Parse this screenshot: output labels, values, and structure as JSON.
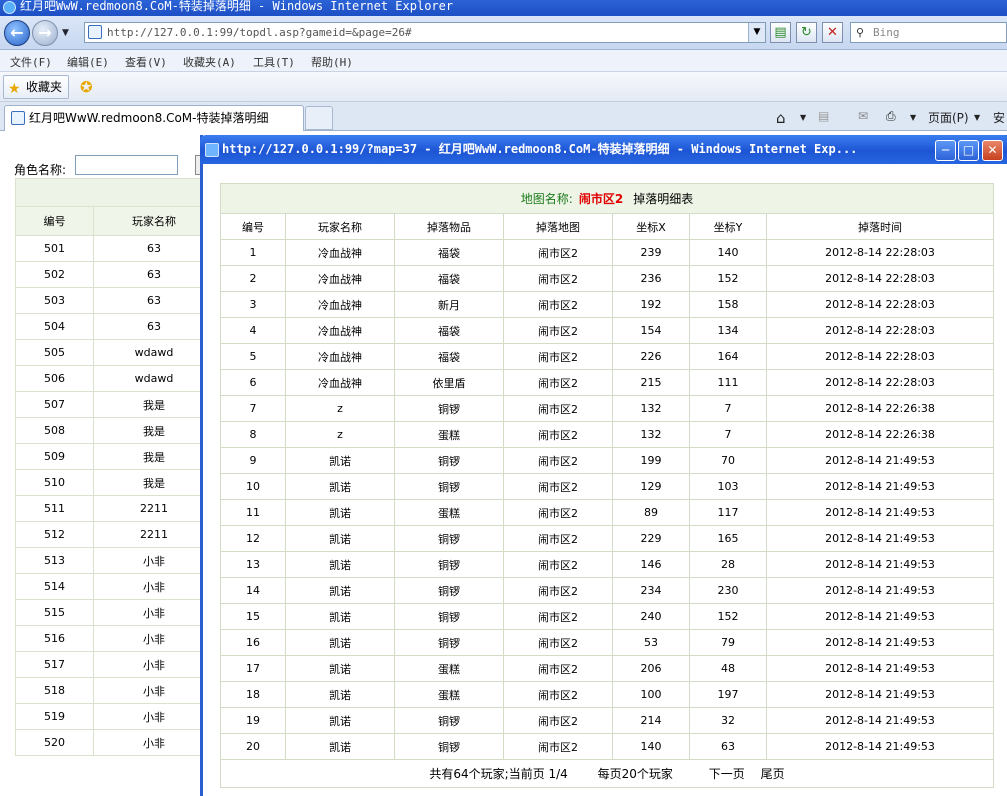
{
  "window": {
    "title": "红月吧WwW.redmoon8.CoM-特装掉落明细 - Windows Internet Explorer"
  },
  "address": {
    "url": "http://127.0.0.1:99/topdl.asp?gameid=&page=26#",
    "search_placeholder": "Bing"
  },
  "menu": [
    "文件(F)",
    "编辑(E)",
    "查看(V)",
    "收藏夹(A)",
    "工具(T)",
    "帮助(H)"
  ],
  "favorites": {
    "label": "收藏夹"
  },
  "tab": {
    "label": "红月吧WwW.redmoon8.CoM-特装掉落明细"
  },
  "commands": {
    "page": "页面(P)",
    "safety": "安"
  },
  "bg_page": {
    "search_label": "角色名称:",
    "headers": [
      "编号",
      "玩家名称"
    ],
    "rows": [
      [
        "501",
        "63"
      ],
      [
        "502",
        "63"
      ],
      [
        "503",
        "63"
      ],
      [
        "504",
        "63"
      ],
      [
        "505",
        "wdawd"
      ],
      [
        "506",
        "wdawd"
      ],
      [
        "507",
        "我是"
      ],
      [
        "508",
        "我是"
      ],
      [
        "509",
        "我是"
      ],
      [
        "510",
        "我是"
      ],
      [
        "511",
        "2211"
      ],
      [
        "512",
        "2211"
      ],
      [
        "513",
        "小非"
      ],
      [
        "514",
        "小非"
      ],
      [
        "515",
        "小非"
      ],
      [
        "516",
        "小非"
      ],
      [
        "517",
        "小非"
      ],
      [
        "518",
        "小非"
      ],
      [
        "519",
        "小非"
      ],
      [
        "520",
        "小非"
      ]
    ]
  },
  "popup": {
    "title": "http://127.0.0.1:99/?map=37 - 红月吧WwW.redmoon8.CoM-特装掉落明细 - Windows Internet Exp...",
    "caption": {
      "label": "地图名称:",
      "map": "闹市区2",
      "suffix": "掉落明细表"
    },
    "headers": [
      "编号",
      "玩家名称",
      "掉落物品",
      "掉落地图",
      "坐标X",
      "坐标Y",
      "掉落时间"
    ],
    "rows": [
      [
        "1",
        "冷血战神",
        "福袋",
        "闹市区2",
        "239",
        "140",
        "2012-8-14 22:28:03"
      ],
      [
        "2",
        "冷血战神",
        "福袋",
        "闹市区2",
        "236",
        "152",
        "2012-8-14 22:28:03"
      ],
      [
        "3",
        "冷血战神",
        "新月",
        "闹市区2",
        "192",
        "158",
        "2012-8-14 22:28:03"
      ],
      [
        "4",
        "冷血战神",
        "福袋",
        "闹市区2",
        "154",
        "134",
        "2012-8-14 22:28:03"
      ],
      [
        "5",
        "冷血战神",
        "福袋",
        "闹市区2",
        "226",
        "164",
        "2012-8-14 22:28:03"
      ],
      [
        "6",
        "冷血战神",
        "依里盾",
        "闹市区2",
        "215",
        "111",
        "2012-8-14 22:28:03"
      ],
      [
        "7",
        "z",
        "铜锣",
        "闹市区2",
        "132",
        "7",
        "2012-8-14 22:26:38"
      ],
      [
        "8",
        "z",
        "蛋糕",
        "闹市区2",
        "132",
        "7",
        "2012-8-14 22:26:38"
      ],
      [
        "9",
        "凯诺",
        "铜锣",
        "闹市区2",
        "199",
        "70",
        "2012-8-14 21:49:53"
      ],
      [
        "10",
        "凯诺",
        "铜锣",
        "闹市区2",
        "129",
        "103",
        "2012-8-14 21:49:53"
      ],
      [
        "11",
        "凯诺",
        "蛋糕",
        "闹市区2",
        "89",
        "117",
        "2012-8-14 21:49:53"
      ],
      [
        "12",
        "凯诺",
        "铜锣",
        "闹市区2",
        "229",
        "165",
        "2012-8-14 21:49:53"
      ],
      [
        "13",
        "凯诺",
        "铜锣",
        "闹市区2",
        "146",
        "28",
        "2012-8-14 21:49:53"
      ],
      [
        "14",
        "凯诺",
        "铜锣",
        "闹市区2",
        "234",
        "230",
        "2012-8-14 21:49:53"
      ],
      [
        "15",
        "凯诺",
        "铜锣",
        "闹市区2",
        "240",
        "152",
        "2012-8-14 21:49:53"
      ],
      [
        "16",
        "凯诺",
        "铜锣",
        "闹市区2",
        "53",
        "79",
        "2012-8-14 21:49:53"
      ],
      [
        "17",
        "凯诺",
        "蛋糕",
        "闹市区2",
        "206",
        "48",
        "2012-8-14 21:49:53"
      ],
      [
        "18",
        "凯诺",
        "蛋糕",
        "闹市区2",
        "100",
        "197",
        "2012-8-14 21:49:53"
      ],
      [
        "19",
        "凯诺",
        "铜锣",
        "闹市区2",
        "214",
        "32",
        "2012-8-14 21:49:53"
      ],
      [
        "20",
        "凯诺",
        "铜锣",
        "闹市区2",
        "140",
        "63",
        "2012-8-14 21:49:53"
      ]
    ],
    "footer": {
      "summary": "共有64个玩家;当前页 1/4",
      "per_page": "每页20个玩家",
      "next": "下一页",
      "last": "尾页"
    }
  }
}
